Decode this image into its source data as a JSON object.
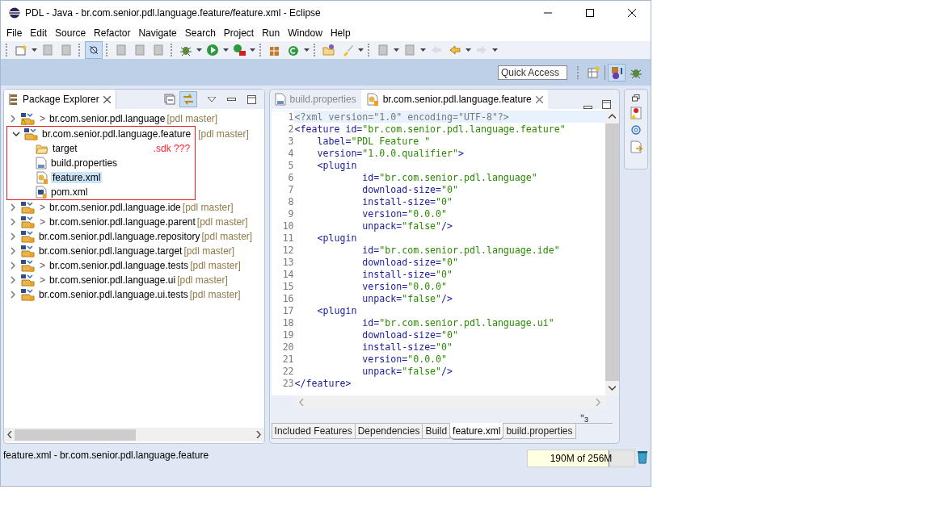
{
  "window": {
    "title": "PDL - Java - br.com.senior.pdl.language.feature/feature.xml - Eclipse"
  },
  "menu": [
    "File",
    "Edit",
    "Source",
    "Refactor",
    "Navigate",
    "Search",
    "Project",
    "Run",
    "Window",
    "Help"
  ],
  "quick_access": {
    "placeholder": "Quick Access"
  },
  "package_explorer": {
    "title": "Package Explorer",
    "items": [
      {
        "label": "br.com.senior.pdl.language",
        "prefix": ">",
        "repo": "[pdl master]",
        "expanded": false,
        "warning": true,
        "selected": false
      },
      {
        "label": "br.com.senior.pdl.language.feature",
        "repo": "[pdl master]",
        "expanded": true,
        "warning": false,
        "selected": false,
        "children": [
          {
            "label": "target",
            "kind": "folder",
            "selected": false
          },
          {
            "label": "build.properties",
            "kind": "properties",
            "selected": false
          },
          {
            "label": "feature.xml",
            "kind": "feature",
            "selected": true
          },
          {
            "label": "pom.xml",
            "kind": "pom",
            "selected": false
          }
        ]
      },
      {
        "label": "br.com.senior.pdl.language.ide",
        "prefix": ">",
        "repo": "[pdl master]",
        "expanded": false,
        "warning": false,
        "selected": false
      },
      {
        "label": "br.com.senior.pdl.language.parent",
        "prefix": ">",
        "repo": "[pdl master]",
        "expanded": false,
        "warning": false,
        "selected": false
      },
      {
        "label": "br.com.senior.pdl.language.repository",
        "repo": "[pdl master]",
        "expanded": false,
        "warning": false,
        "selected": false
      },
      {
        "label": "br.com.senior.pdl.language.target",
        "repo": "[pdl master]",
        "expanded": false,
        "warning": false,
        "selected": false
      },
      {
        "label": "br.com.senior.pdl.language.tests",
        "prefix": ">",
        "repo": "[pdl master]",
        "expanded": false,
        "warning": false,
        "selected": false
      },
      {
        "label": "br.com.senior.pdl.language.ui",
        "prefix": ">",
        "repo": "[pdl master]",
        "expanded": false,
        "warning": false,
        "selected": false
      },
      {
        "label": "br.com.senior.pdl.language.ui.tests",
        "repo": "[pdl master]",
        "expanded": false,
        "warning": false,
        "selected": false
      }
    ],
    "annotation": ".sdk ???"
  },
  "editor": {
    "tabs": [
      {
        "label": "build.properties",
        "kind": "properties",
        "selected": false
      },
      {
        "label": "br.com.senior.pdl.language.feature",
        "kind": "feature",
        "selected": true
      }
    ],
    "lines": [
      {
        "number": "1",
        "text": "<?xml version=\"1.0\" encoding=\"UTF-8\"?>",
        "kind": "declaration",
        "current": true
      },
      {
        "number": "2",
        "text": "<feature id=\"br.com.senior.pdl.language.feature\"",
        "kind": "markup",
        "current": false
      },
      {
        "number": "3",
        "text": "    label=\"PDL Feature \"",
        "kind": "markup",
        "current": false
      },
      {
        "number": "4",
        "text": "    version=\"1.0.0.qualifier\">",
        "kind": "markup",
        "current": false
      },
      {
        "number": "5",
        "text": "    <plugin",
        "kind": "markup",
        "current": false
      },
      {
        "number": "6",
        "text": "            id=\"br.com.senior.pdl.language\"",
        "kind": "markup",
        "current": false
      },
      {
        "number": "7",
        "text": "            download-size=\"0\"",
        "kind": "markup",
        "current": false
      },
      {
        "number": "8",
        "text": "            install-size=\"0\"",
        "kind": "markup",
        "current": false
      },
      {
        "number": "9",
        "text": "            version=\"0.0.0\"",
        "kind": "markup",
        "current": false
      },
      {
        "number": "10",
        "text": "            unpack=\"false\"/>",
        "kind": "markup",
        "current": false
      },
      {
        "number": "11",
        "text": "    <plugin",
        "kind": "markup",
        "current": false
      },
      {
        "number": "12",
        "text": "            id=\"br.com.senior.pdl.language.ide\"",
        "kind": "markup",
        "current": false
      },
      {
        "number": "13",
        "text": "            download-size=\"0\"",
        "kind": "markup",
        "current": false
      },
      {
        "number": "14",
        "text": "            install-size=\"0\"",
        "kind": "markup",
        "current": false
      },
      {
        "number": "15",
        "text": "            version=\"0.0.0\"",
        "kind": "markup",
        "current": false
      },
      {
        "number": "16",
        "text": "            unpack=\"false\"/>",
        "kind": "markup",
        "current": false
      },
      {
        "number": "17",
        "text": "    <plugin",
        "kind": "markup",
        "current": false
      },
      {
        "number": "18",
        "text": "            id=\"br.com.senior.pdl.language.ui\"",
        "kind": "markup",
        "current": false
      },
      {
        "number": "19",
        "text": "            download-size=\"0\"",
        "kind": "markup",
        "current": false
      },
      {
        "number": "20",
        "text": "            install-size=\"0\"",
        "kind": "markup",
        "current": false
      },
      {
        "number": "21",
        "text": "            version=\"0.0.0\"",
        "kind": "markup",
        "current": false
      },
      {
        "number": "22",
        "text": "            unpack=\"false\"/>",
        "kind": "markup",
        "current": false
      },
      {
        "number": "23",
        "text": "</feature>",
        "kind": "markup",
        "current": false
      }
    ],
    "overflow_marker": "»",
    "overflow_count": "3",
    "page_tabs": [
      {
        "label": "Included Features",
        "selected": false
      },
      {
        "label": "Dependencies",
        "selected": false
      },
      {
        "label": "Build",
        "selected": false
      },
      {
        "label": "feature.xml",
        "selected": true
      },
      {
        "label": "build.properties",
        "selected": false
      }
    ]
  },
  "status_bar": {
    "text": "feature.xml - br.com.senior.pdl.language.feature",
    "heap": "190M of 256M",
    "level": 0.76
  }
}
